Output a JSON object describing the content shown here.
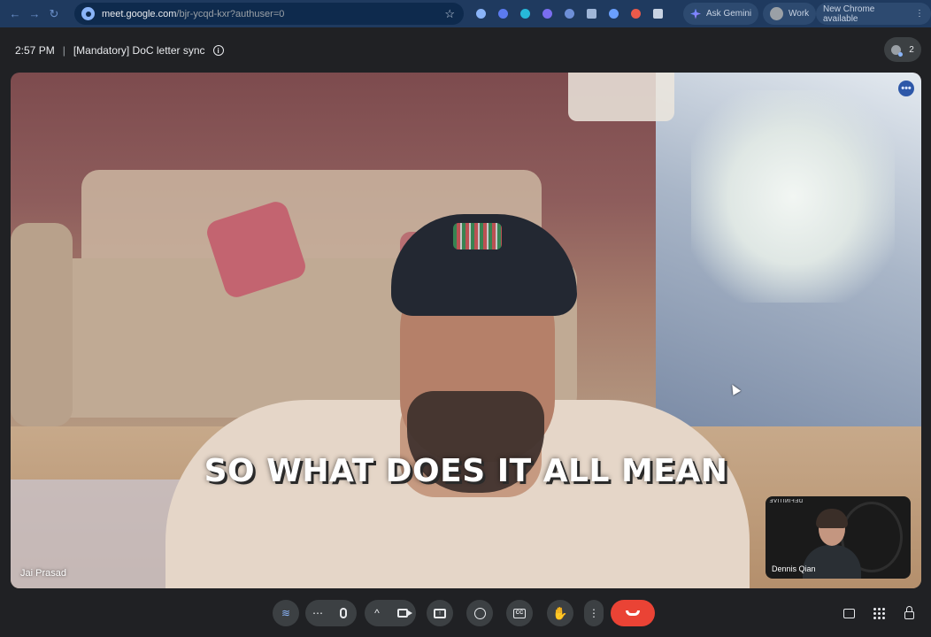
{
  "browser": {
    "url_host": "meet.google.com",
    "url_path": "/bjr-ycqd-kxr?authuser=0",
    "ask_gemini_label": "Ask Gemini",
    "work_label": "Work",
    "update_label": "New Chrome available"
  },
  "meeting": {
    "time": "2:57 PM",
    "separator": "|",
    "title": "[Mandatory] DoC letter sync",
    "participant_count": "2"
  },
  "main_video": {
    "caption": "SO WHAT DOES IT ALL MEAN",
    "participant_name": "Jai Prasad"
  },
  "self_view": {
    "participant_name": "Dennis Qian",
    "shirt_text": "DEFINITIVE"
  },
  "colors": {
    "accent": "#8ab4f8",
    "end_call": "#ea4335",
    "toolbar_button": "#3c4043"
  }
}
